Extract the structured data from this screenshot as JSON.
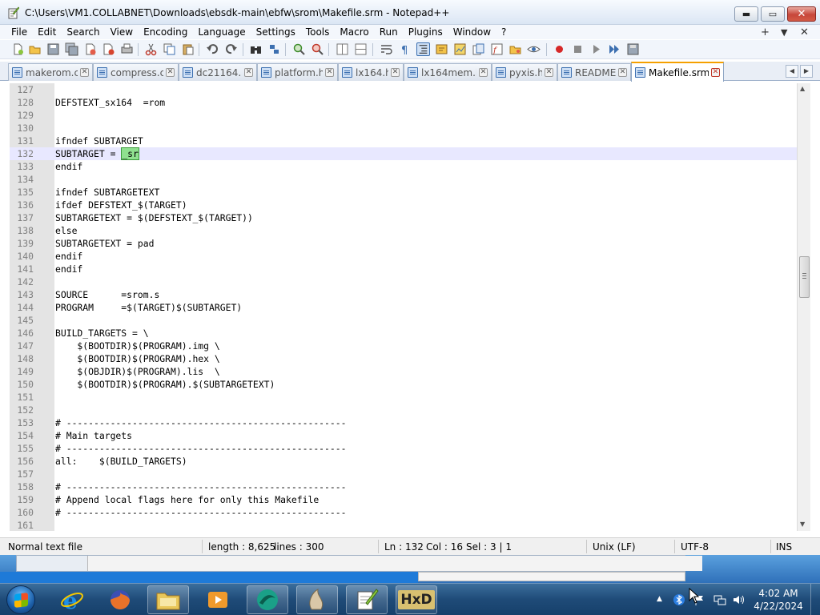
{
  "window": {
    "title": "C:\\Users\\VM1.COLLABNET\\Downloads\\ebsdk-main\\ebfw\\srom\\Makefile.srm - Notepad++",
    "minimize_glyph": "▬",
    "maximize_glyph": "▭",
    "close_glyph": "✕"
  },
  "menu": {
    "items": [
      "File",
      "Edit",
      "Search",
      "View",
      "Encoding",
      "Language",
      "Settings",
      "Tools",
      "Macro",
      "Run",
      "Plugins",
      "Window",
      "?"
    ],
    "plus_glyph": "+",
    "dropdown_glyph": "▼",
    "close_glyph": "✕"
  },
  "tabs": [
    {
      "label": "makerom.c"
    },
    {
      "label": "compress.c"
    },
    {
      "label": "dc21164.h"
    },
    {
      "label": "platform.h"
    },
    {
      "label": "lx164.h"
    },
    {
      "label": "lx164mem.h"
    },
    {
      "label": "pyxis.h"
    },
    {
      "label": "README"
    },
    {
      "label": "Makefile.srm"
    }
  ],
  "tab_close_glyph": "✕",
  "tab_scroll": {
    "left": "◀",
    "right": "▶"
  },
  "editor": {
    "lines": [
      {
        "n": "127",
        "text": ""
      },
      {
        "n": "128",
        "text": "DEFSTEXT_sx164  =rom"
      },
      {
        "n": "129",
        "text": ""
      },
      {
        "n": "130",
        "text": ""
      },
      {
        "n": "131",
        "text": "ifndef SUBTARGET"
      },
      {
        "n": "132",
        "text": "SUBTARGET = _sr"
      },
      {
        "n": "133",
        "text": "endif"
      },
      {
        "n": "134",
        "text": ""
      },
      {
        "n": "135",
        "text": "ifndef SUBTARGETEXT"
      },
      {
        "n": "136",
        "text": "ifdef DEFSTEXT_$(TARGET)"
      },
      {
        "n": "137",
        "text": "SUBTARGETEXT = $(DEFSTEXT_$(TARGET))"
      },
      {
        "n": "138",
        "text": "else"
      },
      {
        "n": "139",
        "text": "SUBTARGETEXT = pad"
      },
      {
        "n": "140",
        "text": "endif"
      },
      {
        "n": "141",
        "text": "endif"
      },
      {
        "n": "142",
        "text": ""
      },
      {
        "n": "143",
        "text": "SOURCE      =srom.s"
      },
      {
        "n": "144",
        "text": "PROGRAM     =$(TARGET)$(SUBTARGET)"
      },
      {
        "n": "145",
        "text": ""
      },
      {
        "n": "146",
        "text": "BUILD_TARGETS = \\"
      },
      {
        "n": "147",
        "text": "    $(BOOTDIR)$(PROGRAM).img \\"
      },
      {
        "n": "148",
        "text": "    $(BOOTDIR)$(PROGRAM).hex \\"
      },
      {
        "n": "149",
        "text": "    $(OBJDIR)$(PROGRAM).lis  \\"
      },
      {
        "n": "150",
        "text": "    $(BOOTDIR)$(PROGRAM).$(SUBTARGETEXT)"
      },
      {
        "n": "151",
        "text": ""
      },
      {
        "n": "152",
        "text": ""
      },
      {
        "n": "153",
        "text": "# ---------------------------------------------------"
      },
      {
        "n": "154",
        "text": "# Main targets"
      },
      {
        "n": "155",
        "text": "# ---------------------------------------------------"
      },
      {
        "n": "156",
        "text": "all:    $(BUILD_TARGETS)"
      },
      {
        "n": "157",
        "text": ""
      },
      {
        "n": "158",
        "text": "# ---------------------------------------------------"
      },
      {
        "n": "159",
        "text": "# Append local flags here for only this Makefile"
      },
      {
        "n": "160",
        "text": "# ---------------------------------------------------"
      },
      {
        "n": "161",
        "text": ""
      }
    ],
    "current_line": "132",
    "selection": {
      "before": "SUBTARGET = ",
      "selected": "_sr",
      "after": ""
    }
  },
  "scrollbar": {
    "up": "▲",
    "down": "▼"
  },
  "status": {
    "type": "Normal text file",
    "length": "length : 8,625",
    "lines": "lines : 300",
    "ln": "Ln : 132",
    "col": "Col : 16",
    "sel": "Sel : 3 | 1",
    "eol": "Unix (LF)",
    "encoding": "UTF-8",
    "mode": "INS"
  },
  "taskbar": {
    "apps": [
      {
        "name": "internet-explorer",
        "color": "#1e90e8"
      },
      {
        "name": "firefox",
        "color": "#e8722a"
      },
      {
        "name": "file-explorer",
        "color": "#e9c75a"
      },
      {
        "name": "media-player",
        "color": "#f09a2c"
      },
      {
        "name": "app-teal",
        "color": "#1aa088"
      },
      {
        "name": "app-beige",
        "color": "#d9c7a8"
      },
      {
        "name": "notepad-plus-plus",
        "color": "#8cc63f"
      },
      {
        "name": "hxd",
        "color": "#d8c070"
      }
    ],
    "hxd_label": "HxD",
    "tray_arrow": "▲",
    "clock_time": "4:02 AM",
    "clock_date": "4/22/2024"
  },
  "colors": {
    "accent_tab": "#f5a000",
    "selection": "#8fe08f",
    "current_line": "#e8e8ff"
  }
}
